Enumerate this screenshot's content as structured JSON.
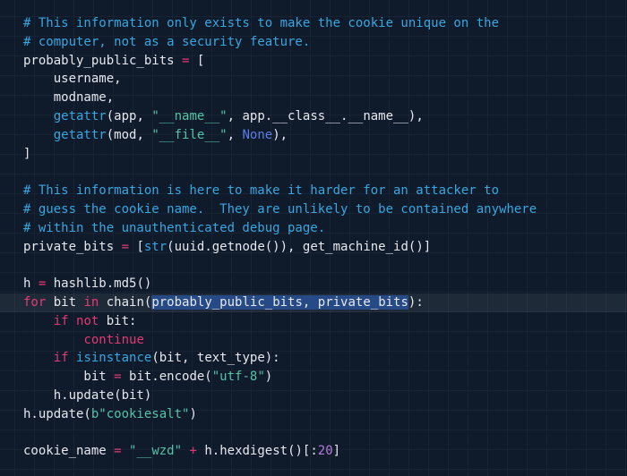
{
  "editor": {
    "current_line": 16,
    "lines": [
      [
        {
          "t": "# This information only exists to make the cookie unique on the",
          "c": "comment"
        }
      ],
      [
        {
          "t": "# computer, not as a security feature.",
          "c": "comment"
        }
      ],
      [
        {
          "t": "probably_public_bits ",
          "c": "plain"
        },
        {
          "t": "=",
          "c": "op"
        },
        {
          "t": " [",
          "c": "plain"
        }
      ],
      [
        {
          "t": "    username,",
          "c": "plain"
        }
      ],
      [
        {
          "t": "    modname,",
          "c": "plain"
        }
      ],
      [
        {
          "t": "    ",
          "c": "plain"
        },
        {
          "t": "getattr",
          "c": "builtin"
        },
        {
          "t": "(app, ",
          "c": "plain"
        },
        {
          "t": "\"__name__\"",
          "c": "string"
        },
        {
          "t": ", app.__class__.__name__),",
          "c": "plain"
        }
      ],
      [
        {
          "t": "    ",
          "c": "plain"
        },
        {
          "t": "getattr",
          "c": "builtin"
        },
        {
          "t": "(mod, ",
          "c": "plain"
        },
        {
          "t": "\"__file__\"",
          "c": "string"
        },
        {
          "t": ", ",
          "c": "plain"
        },
        {
          "t": "None",
          "c": "const"
        },
        {
          "t": "),",
          "c": "plain"
        }
      ],
      [
        {
          "t": "]",
          "c": "plain"
        }
      ],
      [],
      [
        {
          "t": "# This information is here to make it harder for an attacker to",
          "c": "comment"
        }
      ],
      [
        {
          "t": "# guess the cookie name.  They are unlikely to be contained anywhere",
          "c": "comment"
        }
      ],
      [
        {
          "t": "# within the unauthenticated debug page.",
          "c": "comment"
        }
      ],
      [
        {
          "t": "private_bits ",
          "c": "plain"
        },
        {
          "t": "=",
          "c": "op"
        },
        {
          "t": " [",
          "c": "plain"
        },
        {
          "t": "str",
          "c": "builtin"
        },
        {
          "t": "(uuid.getnode()), get_machine_id()]",
          "c": "plain"
        }
      ],
      [],
      [
        {
          "t": "h ",
          "c": "plain"
        },
        {
          "t": "=",
          "c": "op"
        },
        {
          "t": " hashlib.md5()",
          "c": "plain"
        }
      ],
      [
        {
          "t": "for",
          "c": "keyword"
        },
        {
          "t": " bit ",
          "c": "plain"
        },
        {
          "t": "in",
          "c": "keyword"
        },
        {
          "t": " chain(",
          "c": "plain"
        },
        {
          "t": "probably_public_bits, private_bits",
          "c": "sel"
        },
        {
          "t": "):",
          "c": "plain"
        }
      ],
      [
        {
          "t": "    ",
          "c": "plain"
        },
        {
          "t": "if",
          "c": "keyword"
        },
        {
          "t": " ",
          "c": "plain"
        },
        {
          "t": "not",
          "c": "keyword"
        },
        {
          "t": " bit:",
          "c": "plain"
        }
      ],
      [
        {
          "t": "        ",
          "c": "plain"
        },
        {
          "t": "continue",
          "c": "keyword"
        }
      ],
      [
        {
          "t": "    ",
          "c": "plain"
        },
        {
          "t": "if",
          "c": "keyword"
        },
        {
          "t": " ",
          "c": "plain"
        },
        {
          "t": "isinstance",
          "c": "builtin"
        },
        {
          "t": "(bit, text_type):",
          "c": "plain"
        }
      ],
      [
        {
          "t": "        bit ",
          "c": "plain"
        },
        {
          "t": "=",
          "c": "op"
        },
        {
          "t": " bit.encode(",
          "c": "plain"
        },
        {
          "t": "\"utf-8\"",
          "c": "string"
        },
        {
          "t": ")",
          "c": "plain"
        }
      ],
      [
        {
          "t": "    h.update(bit)",
          "c": "plain"
        }
      ],
      [
        {
          "t": "h.update(",
          "c": "plain"
        },
        {
          "t": "b\"cookiesalt\"",
          "c": "string"
        },
        {
          "t": ")",
          "c": "plain"
        }
      ],
      [],
      [
        {
          "t": "cookie_name ",
          "c": "plain"
        },
        {
          "t": "=",
          "c": "op"
        },
        {
          "t": " ",
          "c": "plain"
        },
        {
          "t": "\"__wzd\"",
          "c": "string"
        },
        {
          "t": " ",
          "c": "plain"
        },
        {
          "t": "+",
          "c": "op"
        },
        {
          "t": " h.hexdigest()[:",
          "c": "plain"
        },
        {
          "t": "20",
          "c": "number"
        },
        {
          "t": "]",
          "c": "plain"
        }
      ]
    ]
  },
  "colors": {
    "background": "#0f1a2b",
    "text": "#e6e8ee",
    "comment": "#3aa6df",
    "keyword": "#e23a73",
    "string": "#56c3a6",
    "constant": "#5a7fe6",
    "number": "#b67ad8",
    "selection": "#254a86"
  }
}
